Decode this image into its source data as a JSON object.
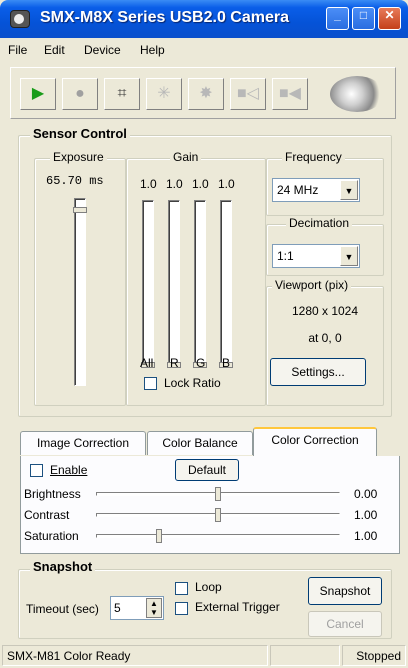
{
  "window": {
    "title": "SMX-M8X Series USB2.0 Camera",
    "controls": [
      "minimize",
      "maximize",
      "close"
    ]
  },
  "menu": [
    {
      "label": "File"
    },
    {
      "label": "Edit"
    },
    {
      "label": "Device"
    },
    {
      "label": "Help"
    }
  ],
  "toolbar": {
    "icons": [
      "play-icon",
      "record-icon",
      "crop-icon",
      "sensor-icon",
      "sensor-settings-icon",
      "camera-in-icon",
      "camera-out-icon",
      "camera-logo-icon"
    ]
  },
  "sensor": {
    "title": "Sensor Control",
    "exposure": {
      "label": "Exposure",
      "value": "65.70 ms",
      "level": 0.95
    },
    "gain": {
      "label": "Gain",
      "values": [
        "1.0",
        "1.0",
        "1.0",
        "1.0"
      ],
      "channels": [
        "All",
        "R",
        "G",
        "B"
      ],
      "levels": [
        0.0,
        0.0,
        0.0,
        0.0
      ],
      "lock_label": "Lock Ratio"
    },
    "frequency": {
      "label": "Frequency",
      "value": "24 MHz"
    },
    "decimation": {
      "label": "Decimation",
      "value": "1:1"
    },
    "viewport": {
      "label": "Viewport (pix)",
      "size": "1280 x 1024",
      "offset": "at 0, 0"
    },
    "settings_button": "Settings..."
  },
  "tabs": [
    {
      "label": "Image Correction"
    },
    {
      "label": "Color Balance"
    },
    {
      "label": "Color Correction",
      "selected": true
    }
  ],
  "color_correction": {
    "enable_label": "Enable",
    "default_button": "Default",
    "rows": [
      {
        "label": "Brightness",
        "value": "0.00",
        "level": 0.5
      },
      {
        "label": "Contrast",
        "value": "1.00",
        "level": 0.5
      },
      {
        "label": "Saturation",
        "value": "1.00",
        "level": 0.25
      }
    ]
  },
  "snapshot": {
    "title": "Snapshot",
    "timeout_label": "Timeout (sec)",
    "timeout_value": "5",
    "loop_label": "Loop",
    "trigger_label": "External Trigger",
    "snapshot_button": "Snapshot",
    "cancel_button": "Cancel"
  },
  "status": {
    "left": "SMX-M81 Color Ready",
    "middle": "",
    "right": "Stopped"
  }
}
